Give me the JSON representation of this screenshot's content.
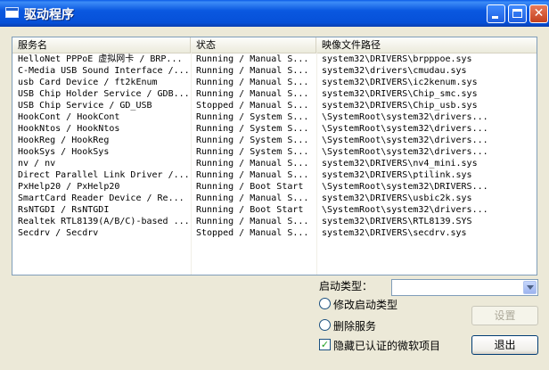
{
  "window": {
    "title": "驱动程序"
  },
  "list": {
    "columns": [
      "服务名",
      "状态",
      "映像文件路径"
    ],
    "rows": [
      [
        "HelloNet PPPoE 虚拟网卡 / BRP...",
        "Running / Manual S...",
        "system32\\DRIVERS\\brpppoe.sys"
      ],
      [
        "C-Media USB Sound Interface /...",
        "Running / Manual S...",
        "system32\\drivers\\cmudau.sys"
      ],
      [
        "usb Card Device / ft2kEnum",
        "Running / Manual S...",
        "system32\\DRIVERS\\ic2kenum.sys"
      ],
      [
        "USB Chip Holder Service / GDB...",
        "Running / Manual S...",
        "system32\\DRIVERS\\Chip_smc.sys"
      ],
      [
        "USB Chip Service / GD_USB",
        "Stopped / Manual S...",
        "system32\\DRIVERS\\Chip_usb.sys"
      ],
      [
        "HookCont / HookCont",
        "Running / System S...",
        "\\SystemRoot\\system32\\drivers..."
      ],
      [
        "HookNtos / HookNtos",
        "Running / System S...",
        "\\SystemRoot\\system32\\drivers..."
      ],
      [
        "HookReg / HookReg",
        "Running / System S...",
        "\\SystemRoot\\system32\\drivers..."
      ],
      [
        "HookSys / HookSys",
        "Running / System S...",
        "\\SystemRoot\\system32\\drivers..."
      ],
      [
        "nv / nv",
        "Running / Manual S...",
        "system32\\DRIVERS\\nv4_mini.sys"
      ],
      [
        "Direct Parallel Link Driver /...",
        "Running / Manual S...",
        "system32\\DRIVERS\\ptilink.sys"
      ],
      [
        "PxHelp20 / PxHelp20",
        "Running / Boot Start",
        "\\SystemRoot\\system32\\DRIVERS..."
      ],
      [
        "SmartCard Reader Device  / Re...",
        "Running / Manual S...",
        "system32\\DRIVERS\\usbic2k.sys"
      ],
      [
        "RsNTGDI / RsNTGDI",
        "Running / Boot Start",
        "\\SystemRoot\\system32\\drivers..."
      ],
      [
        "Realtek RTL8139(A/B/C)-based ...",
        "Running / Manual S...",
        "system32\\DRIVERS\\RTL8139.SYS"
      ],
      [
        "Secdrv / Secdrv",
        "Stopped / Manual S...",
        "system32\\DRIVERS\\secdrv.sys"
      ]
    ]
  },
  "controls": {
    "start_type_label": "启动类型：",
    "start_type_value": "",
    "radio_modify": "修改启动类型",
    "radio_delete": "删除服务",
    "checkbox_hide": "隐藏已认证的微软项目",
    "checkbox_checked_mark": "✓",
    "setup_button": "设置",
    "exit_button": "退出"
  }
}
